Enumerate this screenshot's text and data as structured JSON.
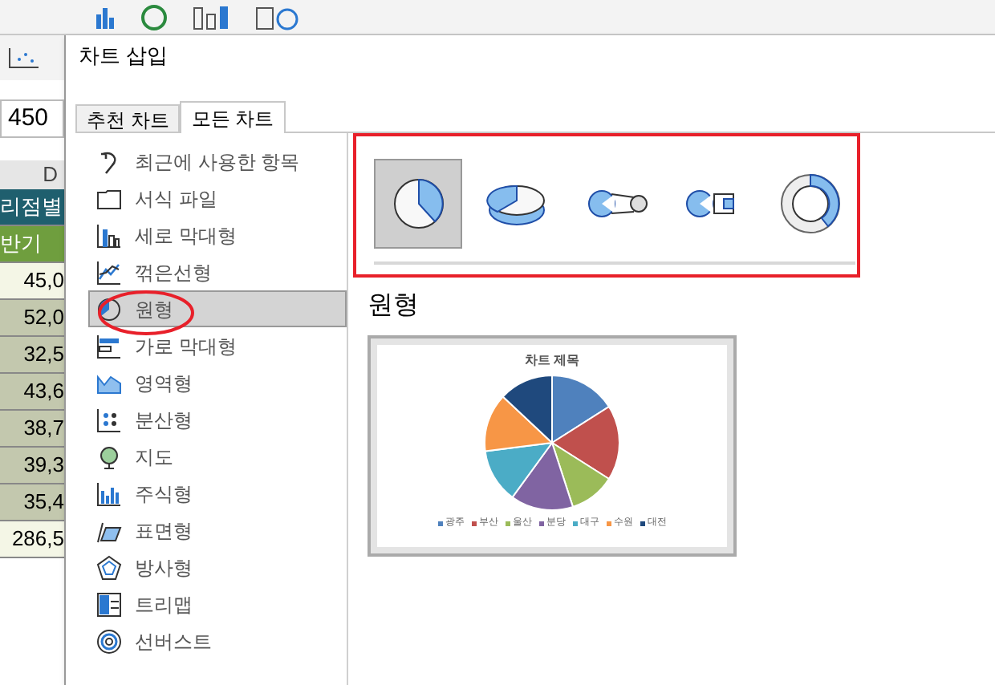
{
  "window": {
    "title": "차트 삽입"
  },
  "tabs": [
    {
      "label": "추천 차트",
      "selected": false
    },
    {
      "label": "모든 차트",
      "selected": true
    }
  ],
  "sidebar": {
    "items": [
      {
        "label": "최근에 사용한 항목",
        "kind": "recent",
        "selected": false
      },
      {
        "label": "서식 파일",
        "kind": "template",
        "selected": false
      },
      {
        "label": "세로 막대형",
        "kind": "column",
        "selected": false
      },
      {
        "label": "꺾은선형",
        "kind": "line",
        "selected": false
      },
      {
        "label": "원형",
        "kind": "pie",
        "selected": true
      },
      {
        "label": "가로 막대형",
        "kind": "bar",
        "selected": false
      },
      {
        "label": "영역형",
        "kind": "area",
        "selected": false
      },
      {
        "label": "분산형",
        "kind": "scatter",
        "selected": false
      },
      {
        "label": "지도",
        "kind": "map",
        "selected": false
      },
      {
        "label": "주식형",
        "kind": "stock",
        "selected": false
      },
      {
        "label": "표면형",
        "kind": "surface",
        "selected": false
      },
      {
        "label": "방사형",
        "kind": "radar",
        "selected": false
      },
      {
        "label": "트리맵",
        "kind": "treemap",
        "selected": false
      },
      {
        "label": "선버스트",
        "kind": "sunburst",
        "selected": false
      }
    ]
  },
  "subtypes": [
    {
      "kind": "pie",
      "selected": true
    },
    {
      "kind": "pie3d",
      "selected": false
    },
    {
      "kind": "pieofpie",
      "selected": false
    },
    {
      "kind": "barofpie",
      "selected": false
    },
    {
      "kind": "donut",
      "selected": false
    }
  ],
  "heading": "원형",
  "preview": {
    "title": "차트 제목",
    "legend": [
      {
        "label": "광주",
        "color": "#4f81bd"
      },
      {
        "label": "부산",
        "color": "#c0504d"
      },
      {
        "label": "울산",
        "color": "#9bbb59"
      },
      {
        "label": "분당",
        "color": "#8064a2"
      },
      {
        "label": "대구",
        "color": "#4bacc6"
      },
      {
        "label": "수원",
        "color": "#f79646"
      },
      {
        "label": "대전",
        "color": "#1f497d"
      }
    ]
  },
  "sheet": {
    "name_box": "450",
    "column": "D",
    "cells": [
      {
        "text": "리점별",
        "kind": "header"
      },
      {
        "text": "반기",
        "kind": "subheader"
      },
      {
        "text": "45,0",
        "kind": "plain"
      },
      {
        "text": "52,0",
        "kind": "shaded"
      },
      {
        "text": "32,5",
        "kind": "shaded"
      },
      {
        "text": "43,6",
        "kind": "shaded"
      },
      {
        "text": "38,7",
        "kind": "shaded"
      },
      {
        "text": "39,3",
        "kind": "shaded"
      },
      {
        "text": "35,4",
        "kind": "shaded"
      },
      {
        "text": "286,5",
        "kind": "plain"
      }
    ]
  }
}
